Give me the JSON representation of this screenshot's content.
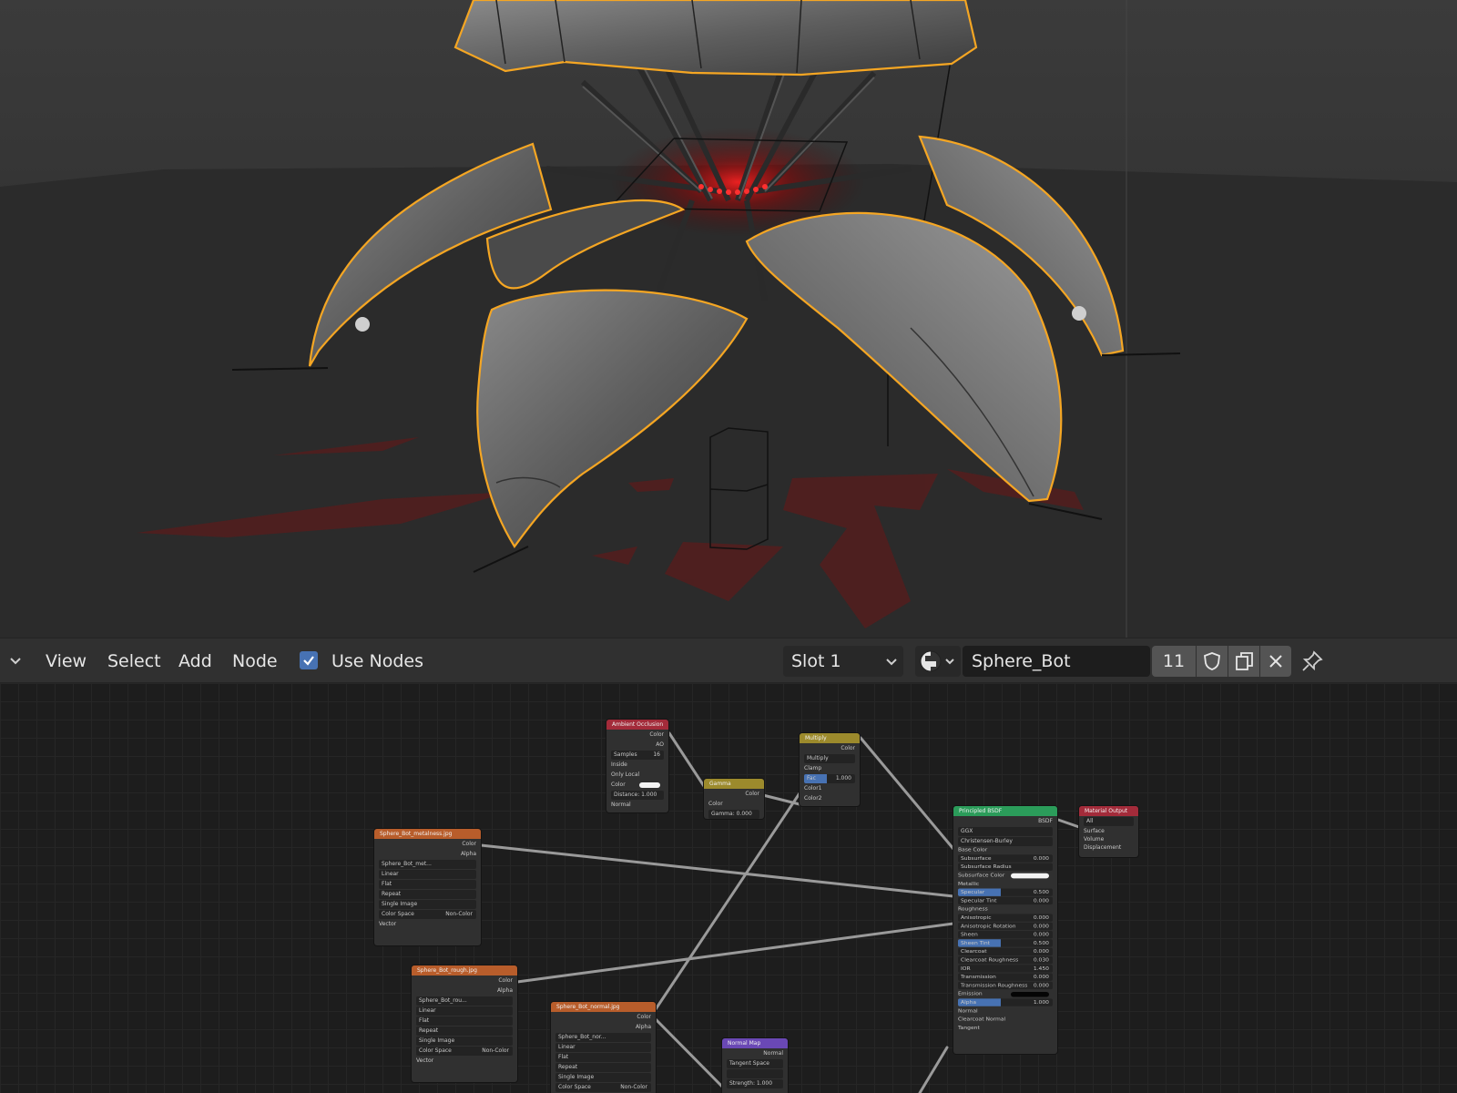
{
  "header": {
    "menus": [
      "View",
      "Select",
      "Add",
      "Node"
    ],
    "use_nodes_label": "Use Nodes",
    "use_nodes_checked": true,
    "slot_label": "Slot 1",
    "material_name": "Sphere_Bot",
    "user_count": "11"
  },
  "nodes": {
    "ambient_occlusion": {
      "title": "Ambient Occlusion",
      "out_color": "Color",
      "out_ao": "AO",
      "samples_label": "Samples",
      "samples_value": "16",
      "inside": "Inside",
      "only_local": "Only Local",
      "color": "Color",
      "distance": "Distance: 1.000",
      "normal": "Normal"
    },
    "gamma": {
      "title": "Gamma",
      "out_color": "Color",
      "in_color": "Color",
      "gamma": "Gamma: 0.000"
    },
    "multiply": {
      "title": "Multiply",
      "out_color": "Color",
      "mode": "Multiply",
      "clamp": "Clamp",
      "fac": "Fac",
      "fac_value": "1.000",
      "color1": "Color1",
      "color2": "Color2"
    },
    "metalness_tex": {
      "title": "Sphere_Bot_metalness.jpg",
      "out_color": "Color",
      "out_alpha": "Alpha",
      "image": "Sphere_Bot_met...",
      "interp": "Linear",
      "proj": "Flat",
      "ext": "Repeat",
      "source": "Single Image",
      "cs_label": "Color Space",
      "cs_value": "Non-Color",
      "vector": "Vector"
    },
    "rough_tex": {
      "title": "Sphere_Bot_rough.jpg",
      "out_color": "Color",
      "out_alpha": "Alpha",
      "image": "Sphere_Bot_rou...",
      "interp": "Linear",
      "proj": "Flat",
      "ext": "Repeat",
      "source": "Single Image",
      "cs_label": "Color Space",
      "cs_value": "Non-Color",
      "vector": "Vector"
    },
    "normal_tex": {
      "title": "Sphere_Bot_normal.jpg",
      "out_color": "Color",
      "out_alpha": "Alpha",
      "image": "Sphere_Bot_nor...",
      "interp": "Linear",
      "proj": "Flat",
      "ext": "Repeat",
      "source": "Single Image",
      "cs_label": "Color Space",
      "cs_value": "Non-Color"
    },
    "normal_map": {
      "title": "Normal Map",
      "out_normal": "Normal",
      "space": "Tangent Space",
      "strength": "Strength: 1.000"
    },
    "principled": {
      "title": "Principled BSDF",
      "out_bsdf": "BSDF",
      "distribution": "GGX",
      "subsurface_method": "Christensen-Burley",
      "rows": [
        {
          "label": "Base Color",
          "value": "",
          "kind": "plain"
        },
        {
          "label": "Subsurface",
          "value": "0.000",
          "kind": "inp"
        },
        {
          "label": "Subsurface Radius",
          "value": "",
          "kind": "inp"
        },
        {
          "label": "Subsurface Color",
          "value": "",
          "kind": "white"
        },
        {
          "label": "Metallic",
          "value": "",
          "kind": "plain"
        },
        {
          "label": "Specular",
          "value": "0.500",
          "kind": "blue"
        },
        {
          "label": "Specular Tint",
          "value": "0.000",
          "kind": "inp"
        },
        {
          "label": "Roughness",
          "value": "",
          "kind": "plain"
        },
        {
          "label": "Anisotropic",
          "value": "0.000",
          "kind": "inp"
        },
        {
          "label": "Anisotropic Rotation",
          "value": "0.000",
          "kind": "inp"
        },
        {
          "label": "Sheen",
          "value": "0.000",
          "kind": "inp"
        },
        {
          "label": "Sheen Tint",
          "value": "0.500",
          "kind": "blue"
        },
        {
          "label": "Clearcoat",
          "value": "0.000",
          "kind": "inp"
        },
        {
          "label": "Clearcoat Roughness",
          "value": "0.030",
          "kind": "inp"
        },
        {
          "label": "IOR",
          "value": "1.450",
          "kind": "inp"
        },
        {
          "label": "Transmission",
          "value": "0.000",
          "kind": "inp"
        },
        {
          "label": "Transmission Roughness",
          "value": "0.000",
          "kind": "inp"
        },
        {
          "label": "Emission",
          "value": "",
          "kind": "black"
        },
        {
          "label": "Alpha",
          "value": "1.000",
          "kind": "blue"
        },
        {
          "label": "Normal",
          "value": "",
          "kind": "plain"
        },
        {
          "label": "Clearcoat Normal",
          "value": "",
          "kind": "plain"
        },
        {
          "label": "Tangent",
          "value": "",
          "kind": "plain"
        }
      ]
    },
    "material_output": {
      "title": "Material Output",
      "target": "All",
      "surface": "Surface",
      "volume": "Volume",
      "displacement": "Displacement"
    }
  },
  "colors": {
    "selection_outline": "#f5a623",
    "header_bg": "#303030",
    "checkbox": "#4772b3",
    "node_input": "#a32b3a",
    "node_color": "#9c8a2c",
    "node_texture": "#b85d2b",
    "node_vector": "#6a48b5",
    "node_shader": "#2b9c5a",
    "node_output": "#a32b3a"
  }
}
